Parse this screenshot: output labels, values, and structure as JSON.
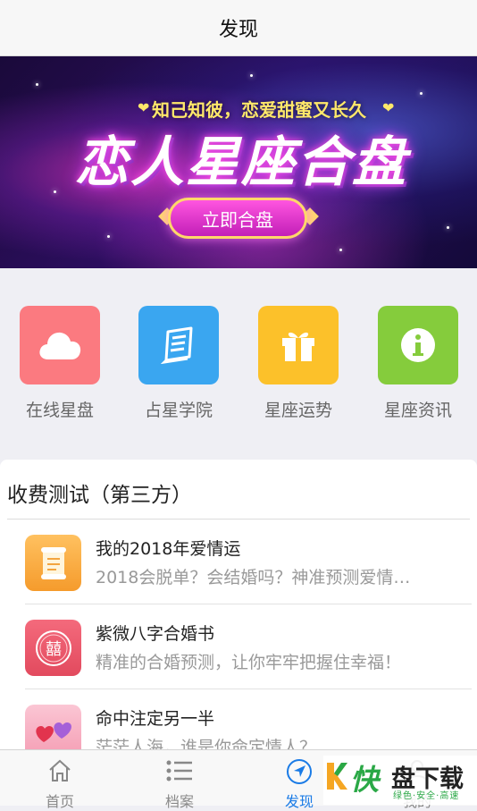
{
  "header": {
    "title": "发现"
  },
  "banner": {
    "subtitle": "知己知彼，恋爱甜蜜又长久",
    "title": "恋人星座合盘",
    "cta_label": "立即合盘"
  },
  "quick_nav": [
    {
      "label": "在线星盘",
      "icon": "cloud-icon",
      "color": "#fb7a80"
    },
    {
      "label": "占星学院",
      "icon": "book-icon",
      "color": "#3aa6f0"
    },
    {
      "label": "星座运势",
      "icon": "gift-icon",
      "color": "#fcc12a"
    },
    {
      "label": "星座资讯",
      "icon": "info-icon",
      "color": "#85cc3c"
    }
  ],
  "paid_section": {
    "title": "收费测试（第三方）",
    "items": [
      {
        "title": "我的2018年爱情运",
        "desc": "2018会脱单？会结婚吗？神准预测爱情…",
        "thumb": "scroll-icon",
        "color": "#f8ac40"
      },
      {
        "title": "紫微八字合婚书",
        "desc": "精准的合婚预测，让你牢牢把握住幸福！",
        "thumb": "double-happiness-icon",
        "color": "#ef5a6e"
      },
      {
        "title": "命中注定另一半",
        "desc": "茫茫人海，谁是你命定情人？",
        "thumb": "hearts-icon",
        "color": "#f7a0b6"
      }
    ]
  },
  "tab_bar": {
    "tabs": [
      {
        "label": "首页",
        "icon": "home-icon"
      },
      {
        "label": "档案",
        "icon": "list-icon"
      },
      {
        "label": "发现",
        "icon": "compass-icon",
        "active": true
      },
      {
        "label": "我的",
        "icon": "user-icon"
      }
    ],
    "active_color": "#1a7be6"
  },
  "watermark": {
    "brand_char": "快",
    "brand_rest": "盘下载",
    "tagline": "绿色·安全·高速",
    "color": "#2aa846"
  }
}
